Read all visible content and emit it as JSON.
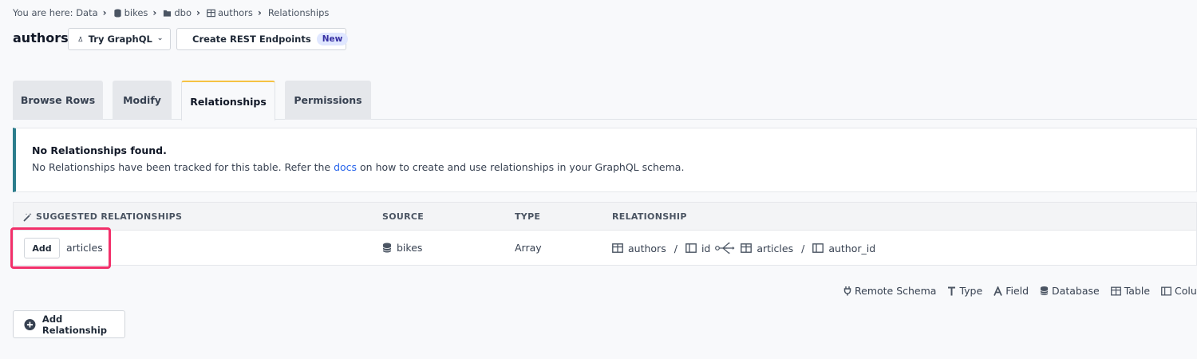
{
  "breadcrumb": {
    "prefix": "You are here:",
    "items": [
      "Data",
      "bikes",
      "dbo",
      "authors",
      "Relationships"
    ]
  },
  "header": {
    "title": "authors",
    "try_graphql": "Try GraphQL",
    "create_rest": "Create REST Endpoints",
    "new_badge": "New"
  },
  "tabs": [
    {
      "label": "Browse Rows",
      "active": false
    },
    {
      "label": "Modify",
      "active": false
    },
    {
      "label": "Relationships",
      "active": true
    },
    {
      "label": "Permissions",
      "active": false
    }
  ],
  "alert": {
    "title": "No Relationships found.",
    "text_before": "No Relationships have been tracked for this table. Refer the ",
    "link": "docs",
    "text_after": " on how to create and use relationships in your GraphQL schema."
  },
  "suggested": {
    "headers": {
      "name": "SUGGESTED RELATIONSHIPS",
      "source": "SOURCE",
      "type": "TYPE",
      "relationship": "RELATIONSHIP"
    },
    "rows": [
      {
        "add_label": "Add",
        "name": "articles",
        "source": "bikes",
        "type": "Array",
        "from_table": "authors",
        "from_column": "id",
        "to_table": "articles",
        "to_column": "author_id",
        "separator": "/"
      }
    ]
  },
  "legend": [
    "Remote Schema",
    "Type",
    "Field",
    "Database",
    "Table",
    "Column"
  ],
  "add_relationship": "Add Relationship",
  "colors": {
    "accent_tab": "#f5c243",
    "alert_border": "#2c7d8c",
    "highlight": "#f2306a",
    "link": "#2563eb"
  }
}
